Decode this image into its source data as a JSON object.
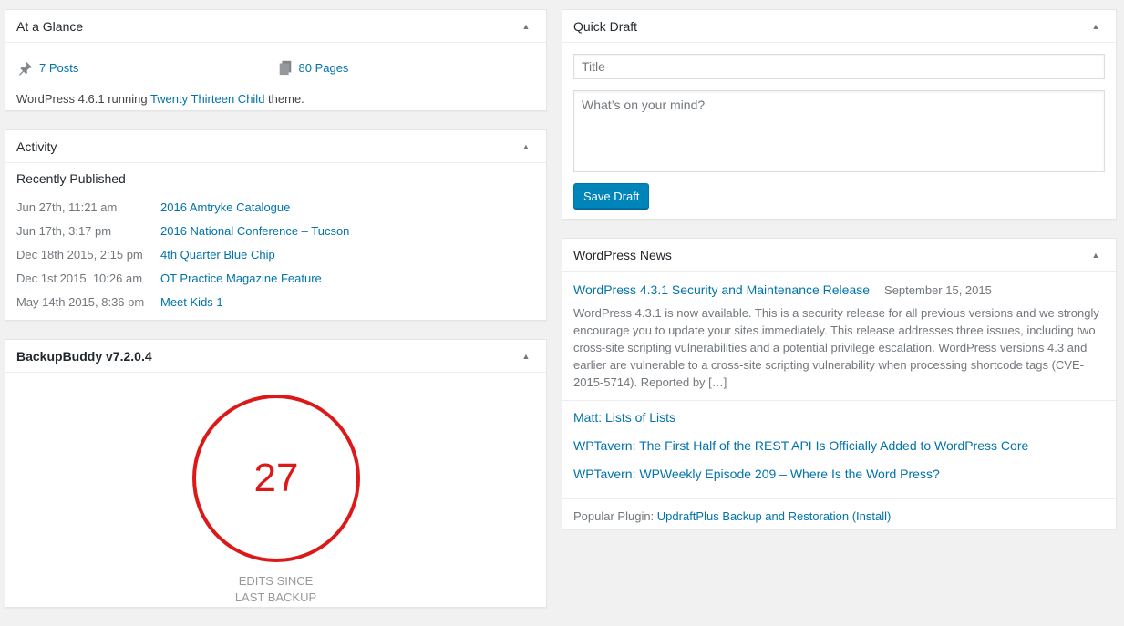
{
  "glance": {
    "title": "At a Glance",
    "posts": "7 Posts",
    "pages": "80 Pages",
    "footer_prefix": "WordPress 4.6.1 running ",
    "theme_link": "Twenty Thirteen Child",
    "footer_suffix": " theme."
  },
  "activity": {
    "title": "Activity",
    "heading": "Recently Published",
    "items": [
      {
        "date": "Jun 27th, 11:21 am",
        "title": "2016 Amtryke Catalogue"
      },
      {
        "date": "Jun 17th, 3:17 pm",
        "title": "2016 National Conference – Tucson"
      },
      {
        "date": "Dec 18th 2015, 2:15 pm",
        "title": "4th Quarter Blue Chip"
      },
      {
        "date": "Dec 1st 2015, 10:26 am",
        "title": "OT Practice Magazine Feature"
      },
      {
        "date": "May 14th 2015, 8:36 pm",
        "title": "Meet Kids 1"
      }
    ]
  },
  "backupbuddy": {
    "title": "BackupBuddy v7.2.0.4",
    "count": "27",
    "caption_line1": "EDITS SINCE",
    "caption_line2": "LAST BACKUP",
    "ring_color": "#dd1818"
  },
  "quickdraft": {
    "title": "Quick Draft",
    "title_placeholder": "Title",
    "content_placeholder": "What’s on your mind?",
    "save_label": "Save Draft"
  },
  "news": {
    "title": "WordPress News",
    "feature_title": "WordPress 4.3.1 Security and Maintenance Release",
    "feature_date": "September 15, 2015",
    "feature_excerpt": "WordPress 4.3.1 is now available. This is a security release for all previous versions and we strongly encourage you to update your sites immediately. This release addresses three issues, including two cross-site scripting vulnerabilities and a potential privilege escalation. WordPress versions 4.3 and earlier are vulnerable to a cross-site scripting vulnerability when processing shortcode tags (CVE-2015-5714). Reported by […]",
    "links": [
      "Matt: Lists of Lists",
      "WPTavern: The First Half of the REST API Is Officially Added to WordPress Core",
      "WPTavern: WPWeekly Episode 209 – Where Is the Word Press?"
    ],
    "plugin_prefix": "Popular Plugin: ",
    "plugin_name": "UpdraftPlus Backup and Restoration",
    "plugin_install": "(Install)"
  },
  "colors": {
    "link": "#0073aa",
    "button": "#0085ba",
    "background": "#f1f1f1"
  },
  "icons": {
    "toggle": "▲"
  }
}
